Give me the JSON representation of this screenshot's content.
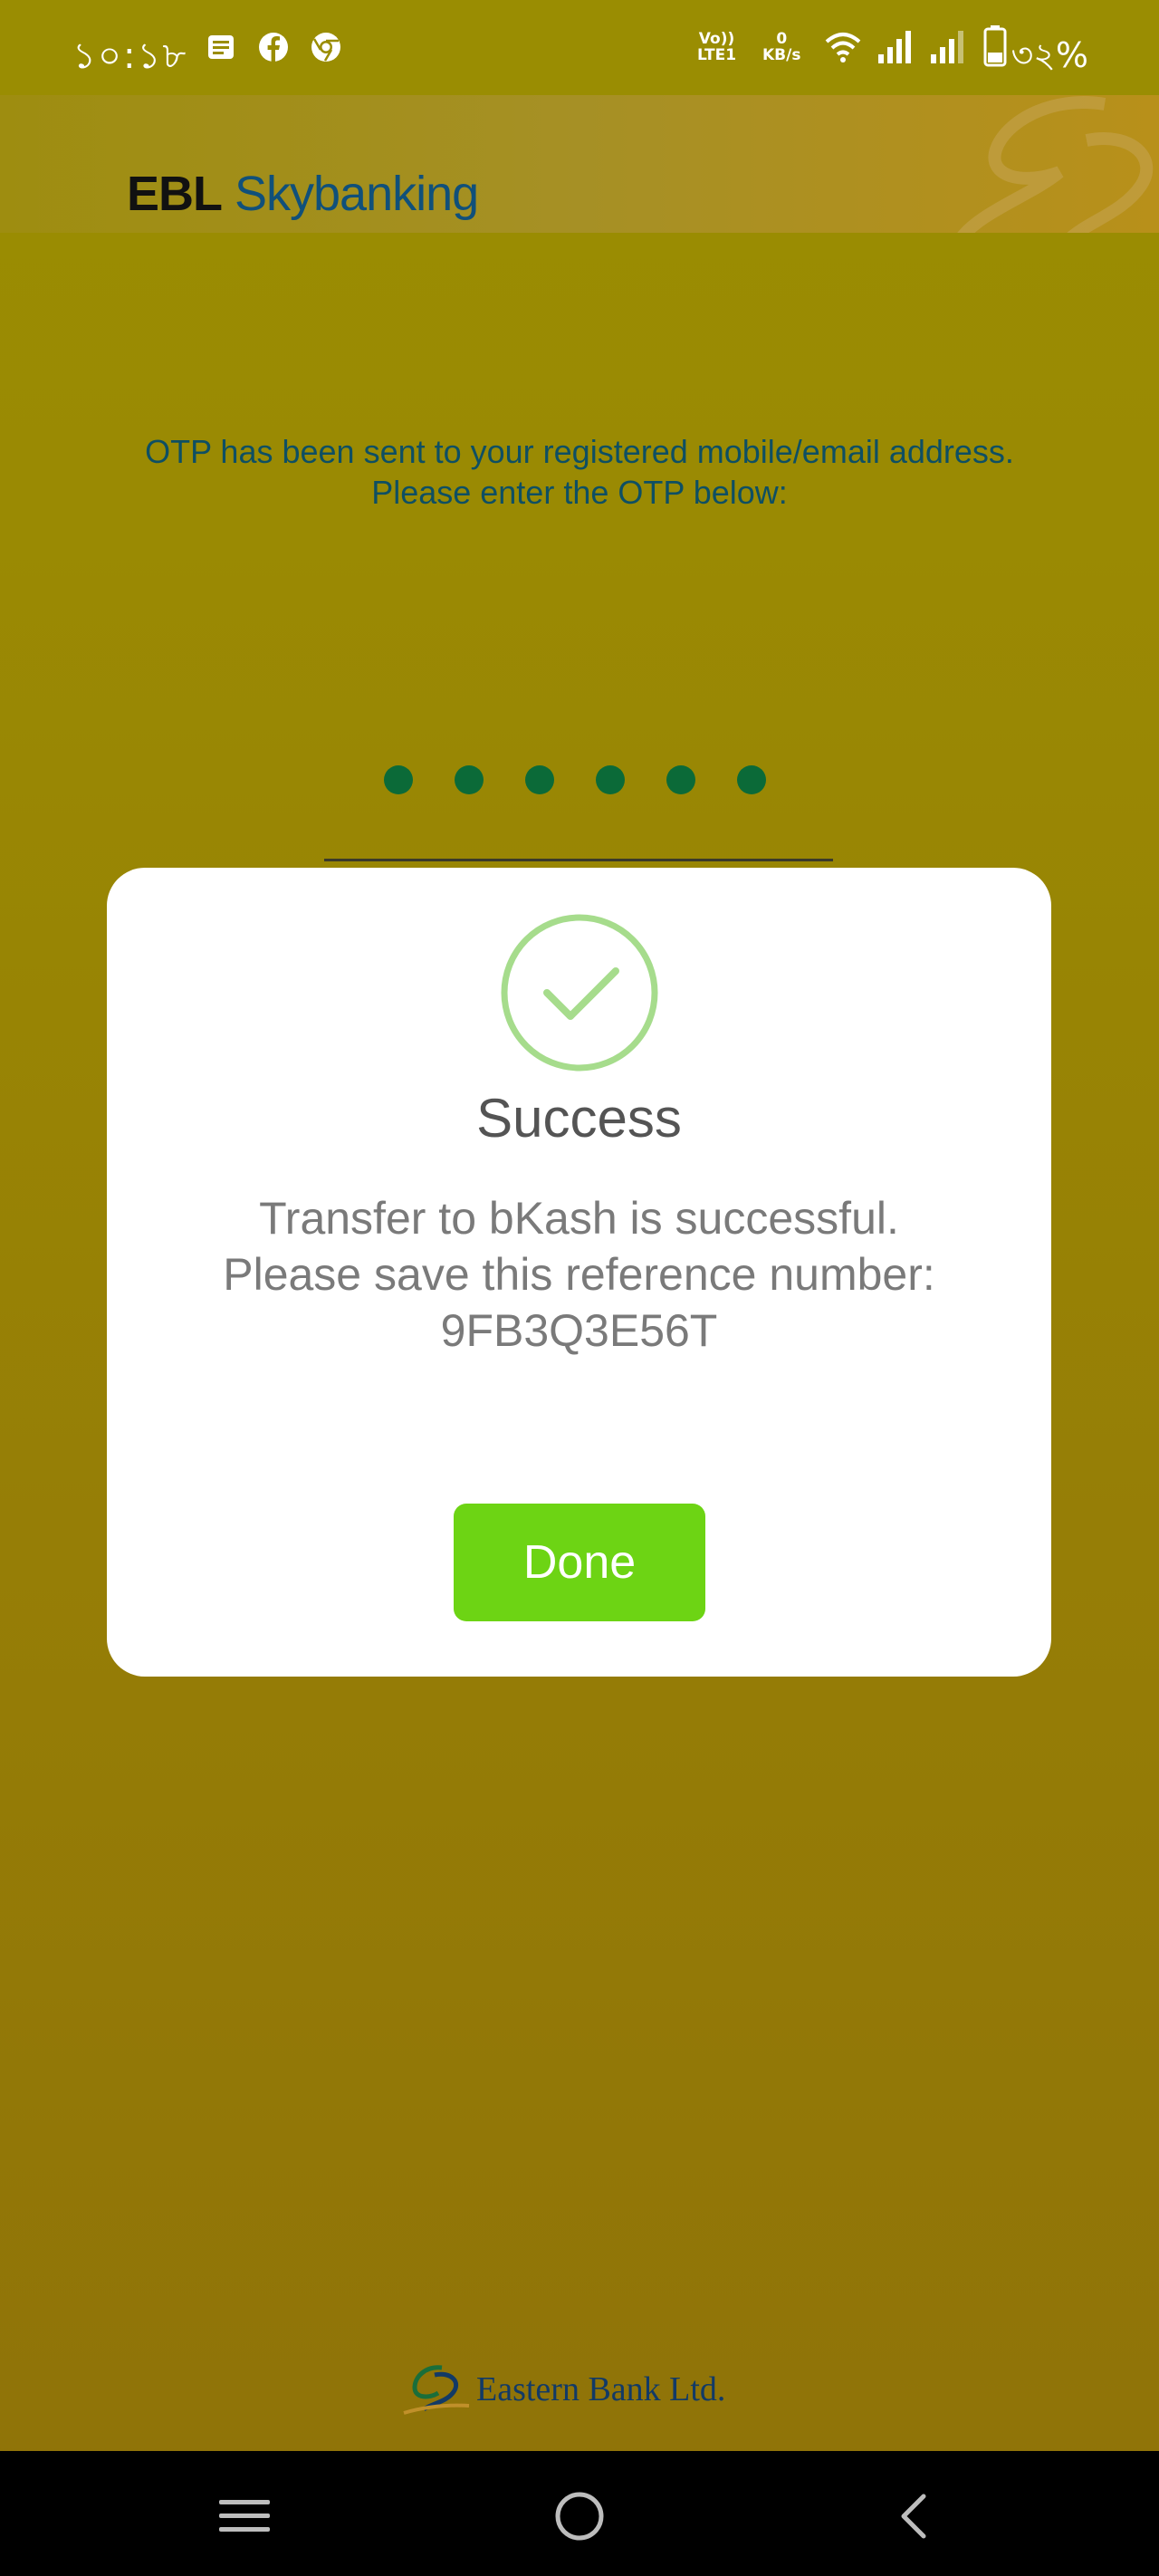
{
  "status_bar": {
    "time": "১০:১৮",
    "left_icons": [
      "news-icon",
      "facebook-icon",
      "chrome-icon"
    ],
    "volte_line1": "Vo))",
    "volte_line2": "LTE1",
    "kbs_line1": "0",
    "kbs_line2": "KB/s",
    "right_icons": [
      "wifi-icon",
      "signal-icon",
      "signal-icon",
      "battery-icon"
    ],
    "battery_text": "৩২%"
  },
  "header": {
    "brand_ebl": "EBL",
    "brand_sky": " Skybanking"
  },
  "otp": {
    "message": "OTP has been sent to your registered mobile/email address. Please enter the OTP below:",
    "digits_entered": 6
  },
  "dialog": {
    "icon": "check-icon",
    "title": "Success",
    "message": "Transfer to bKash is successful. Please save this reference number: 9FB3Q3E56T",
    "done_label": "Done"
  },
  "footer": {
    "brand_name": "Eastern Bank Ltd."
  },
  "nav": {
    "icons": [
      "recent-apps-icon",
      "home-icon",
      "back-icon"
    ]
  },
  "colors": {
    "background": "#9a8d02",
    "otp_text": "#0e4f63",
    "otp_dot": "#0b6a38",
    "check_circle": "#a6dc8c",
    "done_button": "#6dd414"
  }
}
